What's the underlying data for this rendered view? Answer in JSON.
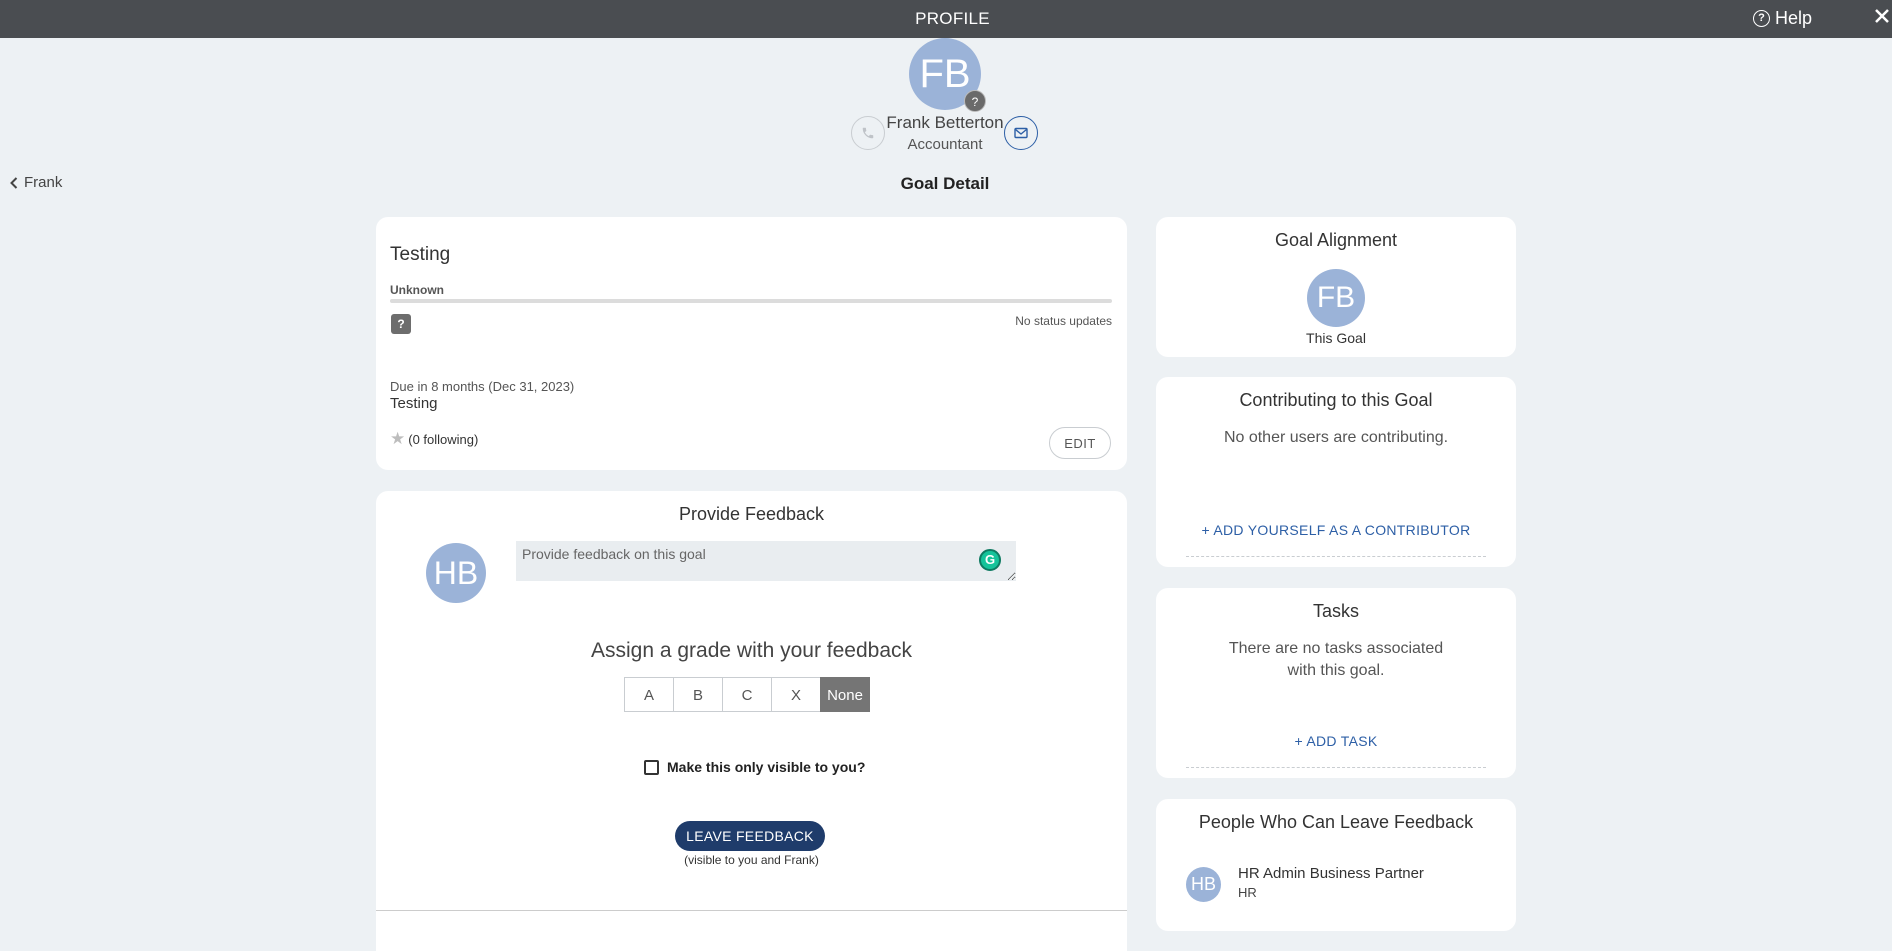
{
  "topbar": {
    "title": "PROFILE",
    "help_label": "Help",
    "close_icon": "close-icon"
  },
  "profile": {
    "initials": "FB",
    "badge": "?",
    "name": "Frank Betterton",
    "role": "Accountant"
  },
  "nav": {
    "back_label": "Frank",
    "page_title": "Goal Detail"
  },
  "goal": {
    "title": "Testing",
    "status": "Unknown",
    "progress": 0,
    "status_icon": "?",
    "no_updates": "No status updates",
    "due": "Due in 8 months (Dec 31, 2023)",
    "description": "Testing",
    "following": "(0 following)",
    "edit_label": "EDIT"
  },
  "feedback": {
    "title": "Provide Feedback",
    "avatar_initials": "HB",
    "placeholder": "Provide feedback on this goal",
    "grammarly_glyph": "G",
    "grade_title": "Assign a grade with your feedback",
    "grades": [
      "A",
      "B",
      "C",
      "X",
      "None"
    ],
    "selected_grade": "None",
    "private_label": "Make this only visible to you?",
    "leave_label": "LEAVE FEEDBACK",
    "visibility_note": "(visible to you and Frank)"
  },
  "alignment": {
    "title": "Goal Alignment",
    "initials": "FB",
    "label": "This Goal"
  },
  "contributing": {
    "title": "Contributing to this Goal",
    "empty_text": "No other users are contributing.",
    "add_label": "+ ADD YOURSELF AS A CONTRIBUTOR"
  },
  "tasks": {
    "title": "Tasks",
    "empty_text": "There are no tasks associated with this goal.",
    "add_label": "+ ADD TASK"
  },
  "people": {
    "title": "People Who Can Leave Feedback",
    "items": [
      {
        "initials": "HB",
        "name": "HR Admin Business Partner",
        "role": "HR"
      }
    ]
  },
  "colors": {
    "topbar": "#4a4d51",
    "avatar": "#9bb3d8",
    "primary_button": "#1f3c6b",
    "link": "#2d5fa6",
    "background": "#edf1f4"
  }
}
